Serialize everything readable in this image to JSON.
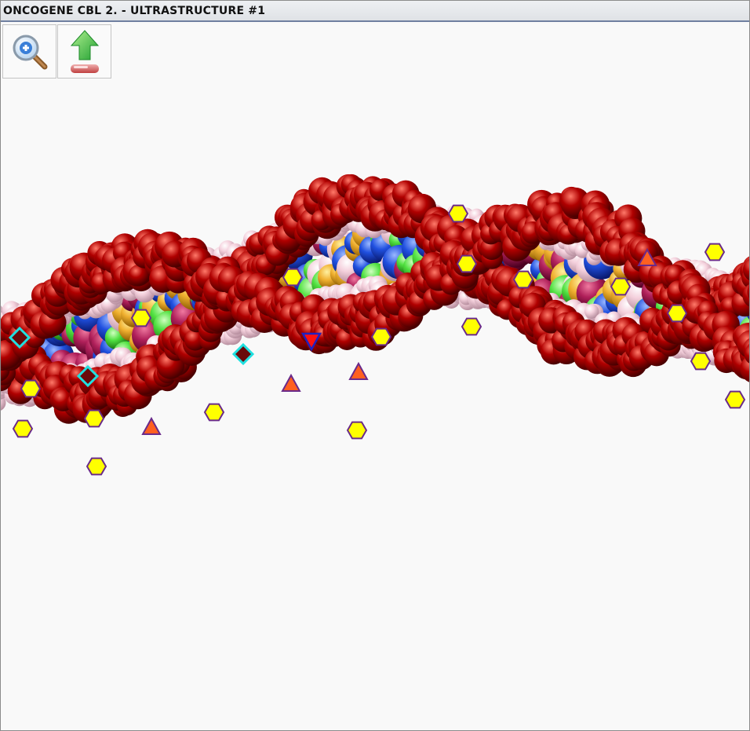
{
  "window": {
    "title": "ONCOGENE CBL 2. - ULTRASTRUCTURE #1"
  },
  "toolbar": {
    "buttons": [
      {
        "icon": "zoom-in-magnifier-icon"
      },
      {
        "icon": "upload-export-arrow-icon"
      }
    ]
  },
  "colors": {
    "backbone_red": "#b00000",
    "pale_pink": "#f4d0dc",
    "magenta": "#b0205a",
    "blue": "#2050e0",
    "green": "#50e040",
    "orange": "#f0b030",
    "marker_yellow": "#ffff00",
    "marker_outline": "#6a2a8a",
    "diamond_fill": "#6a0a0a",
    "diamond_outline": "#20e0e0",
    "triangle_fill": "#ff6020"
  },
  "markers": {
    "hexagon": "hexagon-marker-icon",
    "diamond": "diamond-marker-icon",
    "triangle_up": "triangle-up-marker-icon",
    "triangle_down": "triangle-down-marker-icon"
  }
}
